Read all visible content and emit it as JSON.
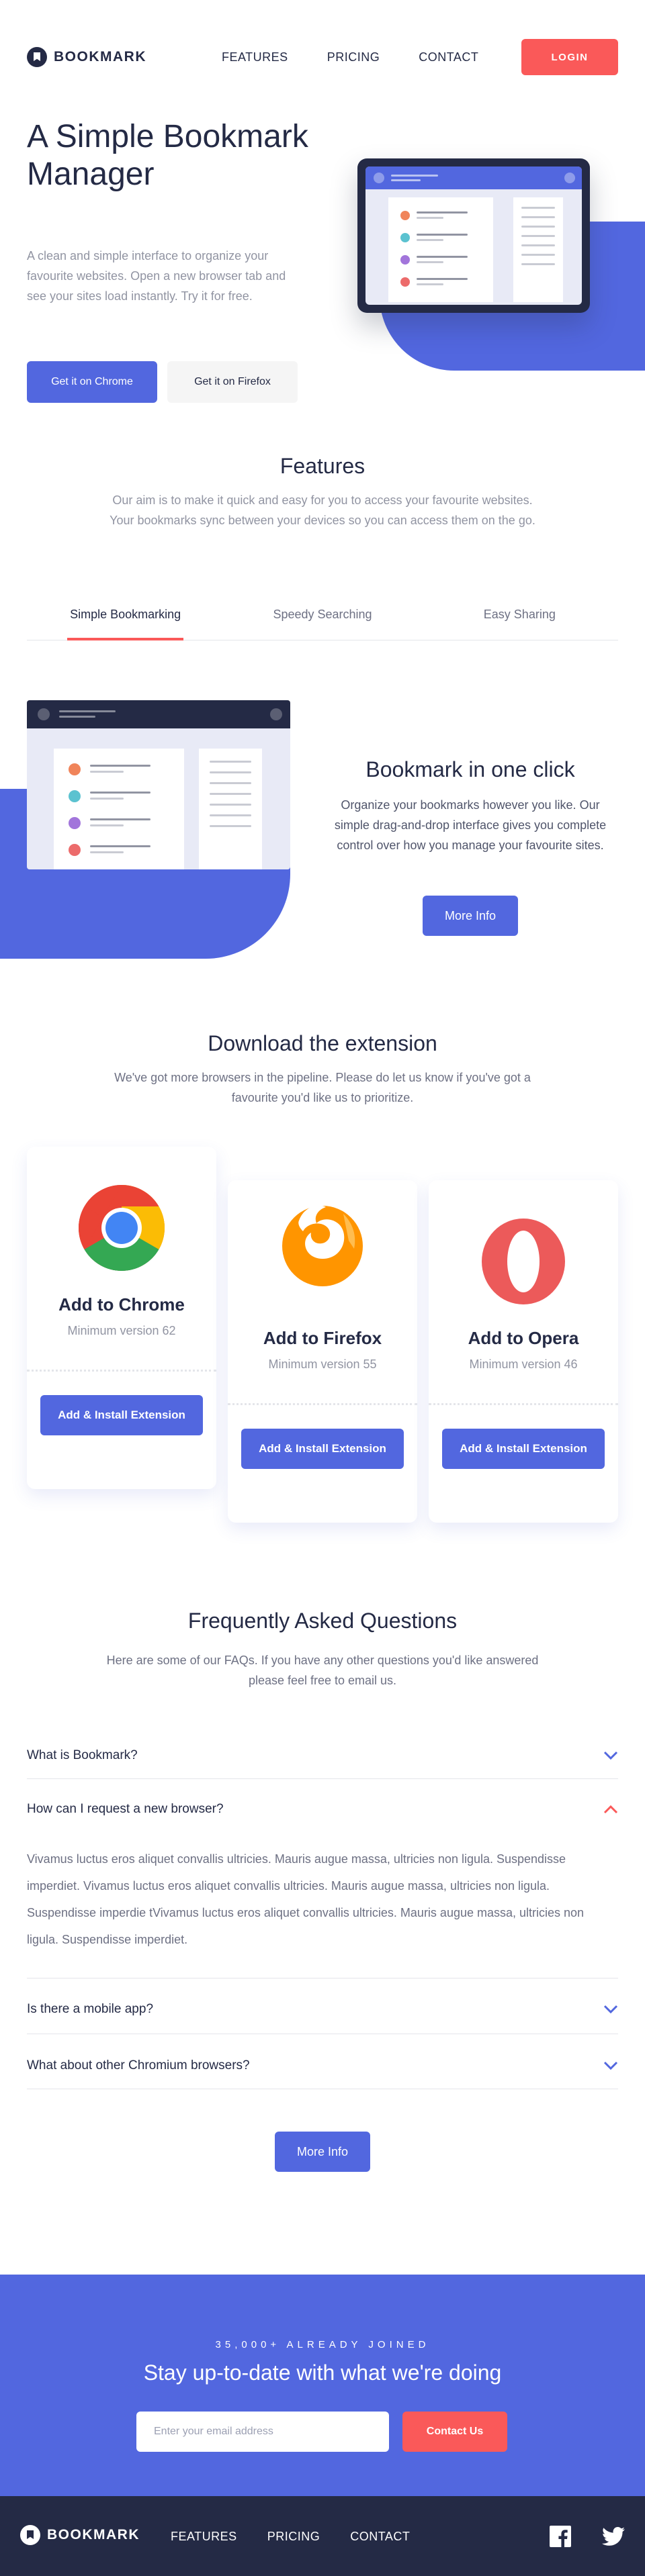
{
  "brand": {
    "name": "BOOKMARK"
  },
  "nav": {
    "links": [
      "FEATURES",
      "PRICING",
      "CONTACT"
    ],
    "login": "LOGIN"
  },
  "hero": {
    "title": "A Simple Bookmark Manager",
    "description": "A clean and simple interface to organize your favourite websites. Open a new browser tab and see your sites load instantly. Try it for free.",
    "btn_chrome": "Get it on Chrome",
    "btn_firefox": "Get it on Firefox"
  },
  "features": {
    "title": "Features",
    "description": "Our aim is to make it quick and easy for you to access your favourite websites. Your bookmarks sync between your devices so you can access them on the go.",
    "tabs": [
      "Simple Bookmarking",
      "Speedy Searching",
      "Easy Sharing"
    ],
    "active_tab": "Simple Bookmarking",
    "panel_title": "Bookmark in one click",
    "panel_description": "Organize your bookmarks however you like. Our simple drag-and-drop interface gives you complete control over how you manage your favourite sites.",
    "more_info": "More Info"
  },
  "extensions": {
    "title": "Download the extension",
    "description": "We've got more browsers in the pipeline. Please do let us know if you've got a favourite you'd like us to prioritize.",
    "cards": [
      {
        "title": "Add to Chrome",
        "version": "Minimum version 62",
        "button": "Add & Install Extension",
        "icon": "chrome-icon"
      },
      {
        "title": "Add to Firefox",
        "version": "Minimum version 55",
        "button": "Add & Install Extension",
        "icon": "firefox-icon"
      },
      {
        "title": "Add to Opera",
        "version": "Minimum version 46",
        "button": "Add & Install Extension",
        "icon": "opera-icon"
      }
    ]
  },
  "faq": {
    "title": "Frequently Asked Questions",
    "description": "Here are some of our FAQs. If you have any other questions you'd like answered please feel free to email us.",
    "items": [
      {
        "question": "What is Bookmark?",
        "open": false
      },
      {
        "question": "How can I request a new browser?",
        "open": true
      },
      {
        "question": "Is there a mobile app?",
        "open": false
      },
      {
        "question": "What about other Chromium browsers?",
        "open": false
      }
    ],
    "answer": "Vivamus luctus eros aliquet convallis ultricies. Mauris augue massa, ultricies non ligula. Suspendisse imperdiet. Vivamus luctus eros aliquet convallis ultricies. Mauris augue massa, ultricies non ligula. Suspendisse imperdie tVivamus luctus eros aliquet convallis ultricies. Mauris augue massa, ultricies non ligula. Suspendisse imperdiet.",
    "more_info": "More Info"
  },
  "cta": {
    "kicker": "35,000+ ALREADY JOINED",
    "title": "Stay up-to-date with what we're doing",
    "email_placeholder": "Enter your email address",
    "button": "Contact Us"
  },
  "footer": {
    "links": [
      "FEATURES",
      "PRICING",
      "CONTACT"
    ],
    "social": [
      "facebook-icon",
      "twitter-icon"
    ]
  },
  "colors": {
    "primary": "#5267DF",
    "accent": "#FA5959",
    "dark": "#242A45",
    "muted": "#9194A2"
  }
}
